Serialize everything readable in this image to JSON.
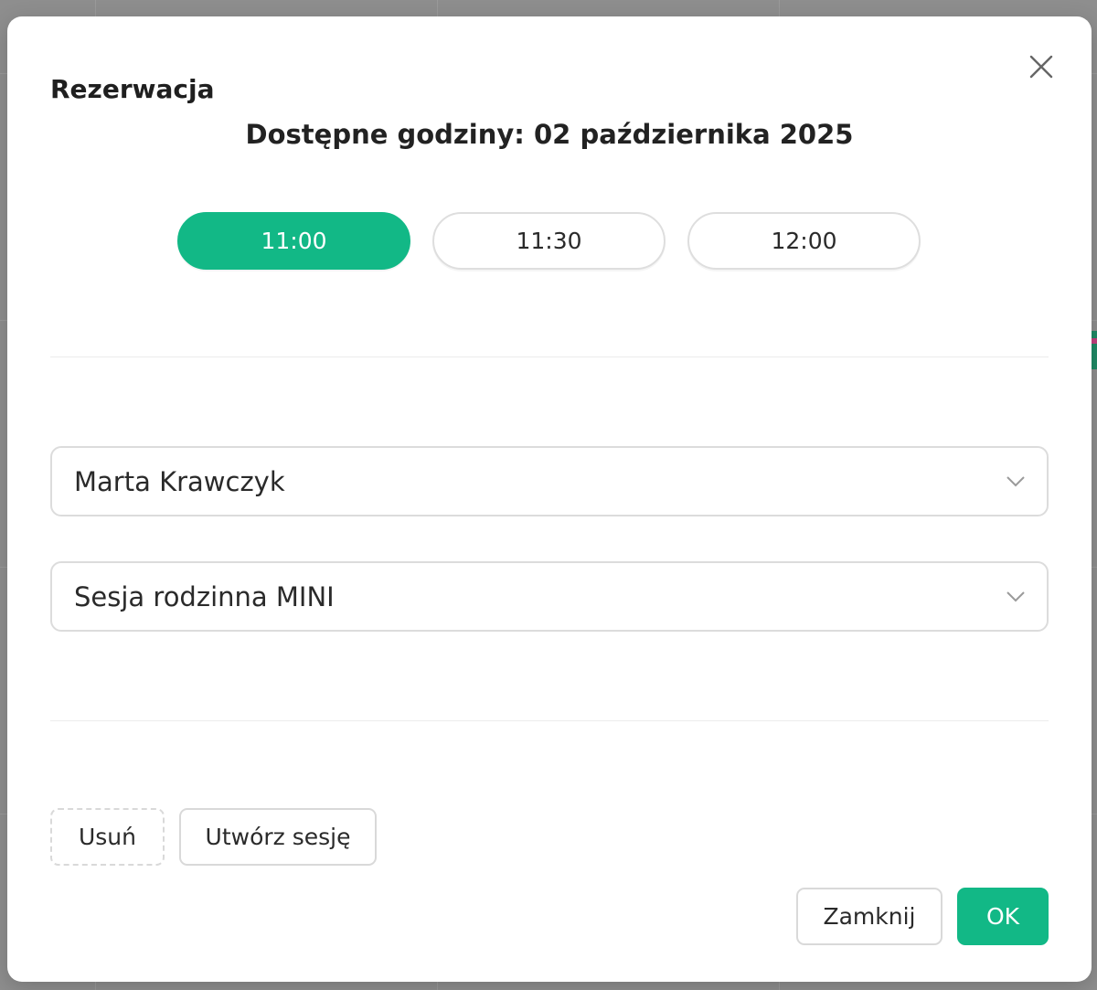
{
  "modal": {
    "title": "Rezerwacja",
    "availability_heading": "Dostępne godziny: 02 października 2025",
    "time_slots": [
      {
        "label": "11:00",
        "selected": true
      },
      {
        "label": "11:30",
        "selected": false
      },
      {
        "label": "12:00",
        "selected": false
      }
    ],
    "client_select": {
      "value": "Marta Krawczyk"
    },
    "session_select": {
      "value": "Sesja rodzinna MINI"
    },
    "buttons": {
      "delete": "Usuń",
      "create_session": "Utwórz sesję",
      "close": "Zamknij",
      "ok": "OK"
    }
  },
  "icons": {
    "close": "close-icon",
    "chevron": "chevron-down-icon"
  },
  "colors": {
    "accent": "#12b886",
    "border": "#dcdcdc",
    "text": "#2a2a2a"
  }
}
